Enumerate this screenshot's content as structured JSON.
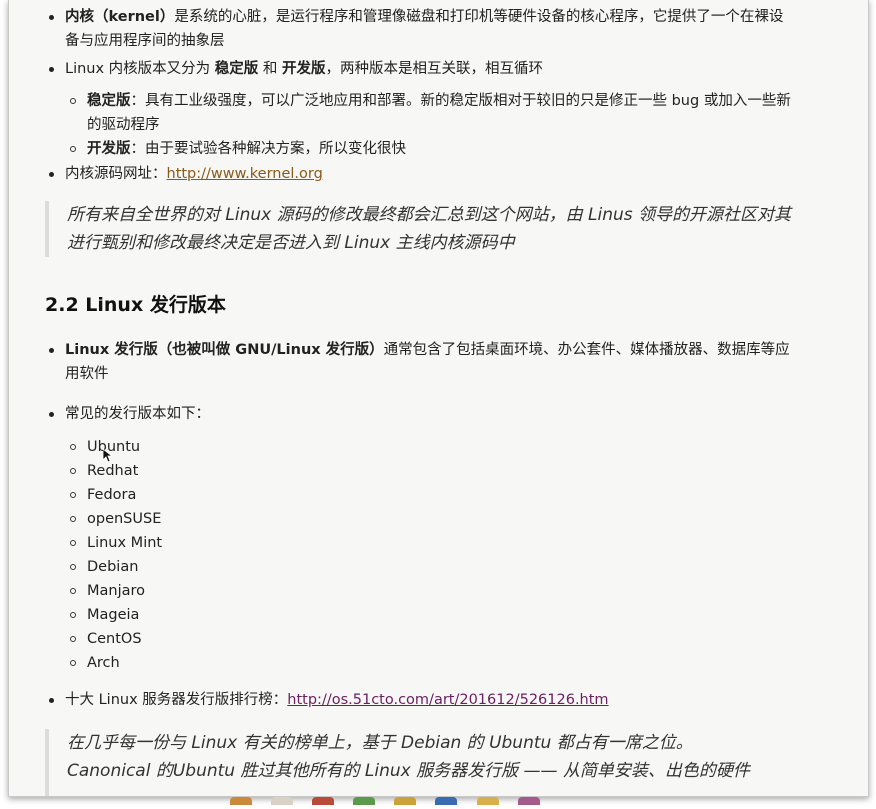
{
  "section1": {
    "items": [
      {
        "label_bold": "内核（kernel）",
        "text": "是系统的心脏，是运行程序和管理像磁盘和打印机等硬件设备的核心程序，它提供了一个在裸设备与应用程序间的抽象层"
      },
      {
        "text_a": "Linux 内核版本又分为 ",
        "bold_a": "稳定版",
        "text_b": " 和 ",
        "bold_b": "开发版",
        "text_c": "，两种版本是相互关联，相互循环"
      }
    ],
    "subitems": [
      {
        "label_bold": "稳定版",
        "text": "：具有工业级强度，可以广泛地应用和部署。新的稳定版相对于较旧的只是修正一些 bug 或加入一些新的驱动程序"
      },
      {
        "label_bold": "开发版",
        "text": "：由于要试验各种解决方案，所以变化很快"
      }
    ],
    "source_label": "内核源码网址：",
    "source_link": "http://www.kernel.org",
    "quote": "所有来自全世界的对 Linux 源码的修改最终都会汇总到这个网站，由 Linus 领导的开源社区对其进行甄别和修改最终决定是否进入到 Linux 主线内核源码中"
  },
  "section2": {
    "heading": "2.2 Linux 发行版本",
    "intro_bold": "Linux 发行版（也被叫做 GNU/Linux 发行版）",
    "intro_text": "通常包含了包括桌面环境、办公套件、媒体播放器、数据库等应用软件",
    "common_label": "常见的发行版本如下：",
    "distros": [
      "Ubuntu",
      "Redhat",
      "Fedora",
      "openSUSE",
      "Linux Mint",
      "Debian",
      "Manjaro",
      "Mageia",
      "CentOS",
      "Arch"
    ],
    "ranking_label": "十大 Linux 服务器发行版排行榜：",
    "ranking_link": "http://os.51cto.com/art/201612/526126.htm",
    "quote_line1": "在几乎每一份与 Linux 有关的榜单上，基于 Debian 的 Ubuntu 都占有一席之位。",
    "quote_line2": "Canonical 的Ubuntu 胜过其他所有的 Linux 服务器发行版 —— 从简单安装、出色的硬件"
  }
}
